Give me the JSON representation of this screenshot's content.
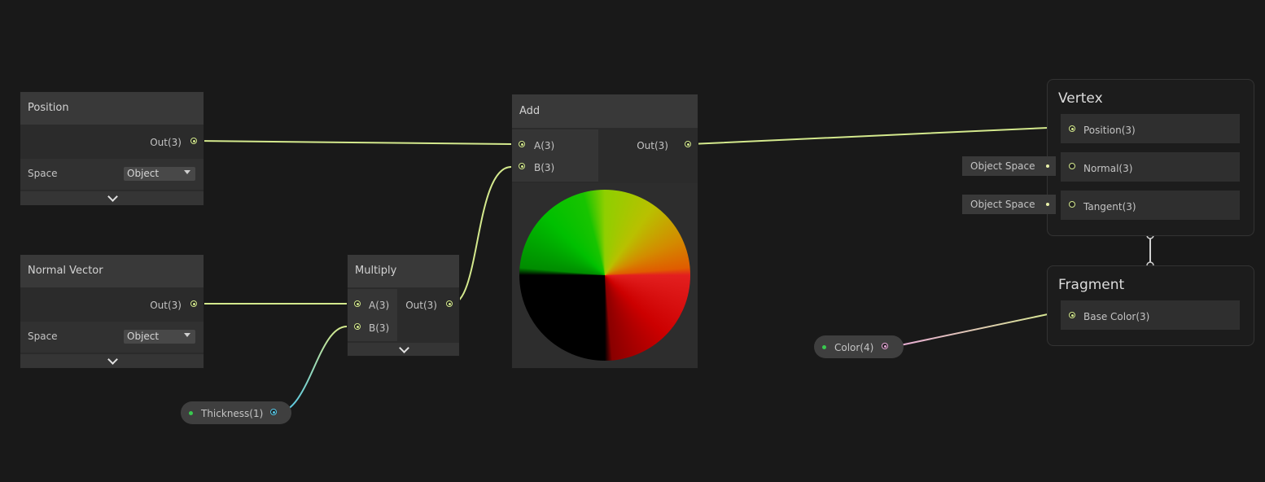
{
  "nodes": {
    "position": {
      "title": "Position",
      "out_label": "Out(3)",
      "space_label": "Space",
      "space_value": "Object"
    },
    "normal_vector": {
      "title": "Normal Vector",
      "out_label": "Out(3)",
      "space_label": "Space",
      "space_value": "Object"
    },
    "multiply": {
      "title": "Multiply",
      "in_a": "A(3)",
      "in_b": "B(3)",
      "out_label": "Out(3)"
    },
    "add": {
      "title": "Add",
      "in_a": "A(3)",
      "in_b": "B(3)",
      "out_label": "Out(3)"
    }
  },
  "properties": {
    "thickness": "Thickness(1)",
    "color": "Color(4)"
  },
  "master_stack": {
    "vertex": {
      "title": "Vertex",
      "blocks": [
        "Position(3)",
        "Normal(3)",
        "Tangent(3)"
      ],
      "contexts": [
        "Object Space",
        "Object Space"
      ]
    },
    "fragment": {
      "title": "Fragment",
      "blocks": [
        "Base Color(3)"
      ]
    }
  },
  "colors": {
    "vector3_wire": "#d4e98d",
    "float_wire": "#55c7e6",
    "color_wire": "#e8a7d8",
    "background": "#191919"
  }
}
